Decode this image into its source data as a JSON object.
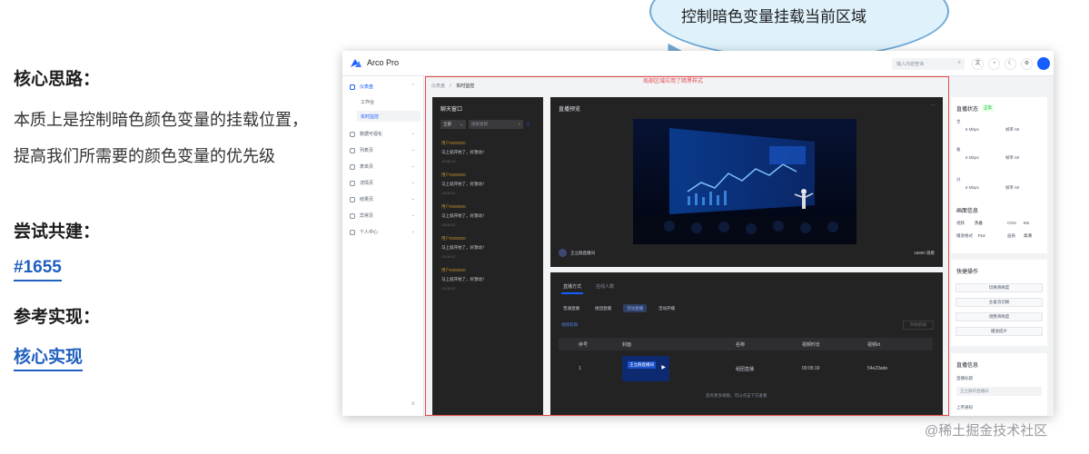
{
  "bubble": {
    "text": "控制暗色变量挂载当前区域"
  },
  "notes": {
    "core_heading": "核心思路：",
    "core_line1": "本质上是控制暗色颜色变量的挂载位置，",
    "core_line2": "提高我们所需要的颜色变量的优先级",
    "try_heading": "尝试共建：",
    "issue_link": "#1655",
    "ref_heading": "参考实现：",
    "ref_link": "核心实现"
  },
  "app": {
    "brand": "Arco Pro",
    "search_placeholder": "输入内容查询",
    "breadcrumb_root": "仪表盘",
    "breadcrumb_current": "实时监控",
    "local_dark_label": "局部区域应用了暗黑样式",
    "sidebar": [
      {
        "label": "仪表盘",
        "icon": "dashboard-icon"
      },
      {
        "label": "数据可视化",
        "icon": "chart-icon"
      },
      {
        "label": "列表页",
        "icon": "list-icon"
      },
      {
        "label": "表单页",
        "icon": "form-icon"
      },
      {
        "label": "详情页",
        "icon": "detail-icon"
      },
      {
        "label": "结果页",
        "icon": "result-icon"
      },
      {
        "label": "异常页",
        "icon": "warning-icon"
      },
      {
        "label": "个人中心",
        "icon": "user-icon"
      }
    ],
    "sidebar_sub": [
      "工作台",
      "实时监控"
    ],
    "chat": {
      "title": "聊天窗口",
      "filter": "全部",
      "search": "搜索类目",
      "messages": [
        {
          "name": "用户0000000",
          "text": "马上就开始了，好激动！",
          "time": "13:09:12"
        },
        {
          "name": "用户0000000",
          "text": "马上就开始了，好激动！",
          "time": "13:09:12"
        },
        {
          "name": "用户0000000",
          "text": "马上就开始了，好激动！",
          "time": "13:09:12"
        },
        {
          "name": "用户0000000",
          "text": "马上就开始了，好激动！",
          "time": "13:09:12"
        },
        {
          "name": "用户0000000",
          "text": "马上就开始了，好激动！",
          "time": "13:09:12"
        }
      ]
    },
    "live": {
      "title": "直播预览",
      "streamer": "王立群直播间",
      "viewers": "18800 观看"
    },
    "table_panel": {
      "tabs": [
        "直播方式",
        "在线人数"
      ],
      "pills": [
        "普通直播",
        "组团直播",
        "活动直播",
        "活动开播"
      ],
      "link": "视频剪辑",
      "action": "开始剪辑",
      "columns": [
        "序号",
        "封面",
        "名称",
        "视频时长",
        "视频id"
      ],
      "row": {
        "index": "1",
        "cover_text": "王立群直播间",
        "name": "组团直播",
        "duration": "00:05:19",
        "id": "54e23ade"
      },
      "footer": "还有更多视频，可以点击下方查看"
    },
    "right": {
      "status_title": "直播状态",
      "status_badge": "正常",
      "rows": [
        {
          "label": "主",
          "rate": "6 Mbps",
          "frame": "帧率 60"
        },
        {
          "label": "备",
          "rate": "6 Mbps",
          "frame": "帧率 60"
        },
        {
          "label": "分",
          "rate": "6 Mbps",
          "frame": "帧率 60"
        }
      ],
      "picture_title": "画面信息",
      "picture": [
        {
          "k": "视频",
          "v": "热备",
          "k2": "CDN",
          "v2": "KS"
        },
        {
          "k": "播放格式",
          "v": "FLV",
          "k2": "画质",
          "v2": "高清"
        }
      ],
      "quick_title": "快捷操作",
      "quick_buttons": [
        "切换清晰度",
        "主备流切换",
        "调整清晰度",
        "播放提片"
      ],
      "info_title": "直播信息",
      "info_label": "直播标题",
      "info_placeholder": "王立群的直播间",
      "info_more": "上传通知"
    }
  },
  "watermark": "@稀土掘金技术社区",
  "colors": {
    "accent": "#165dff",
    "red_outline": "#e54c4c",
    "dark_panel": "#232324",
    "bubble_fill": "#dff1fb"
  }
}
